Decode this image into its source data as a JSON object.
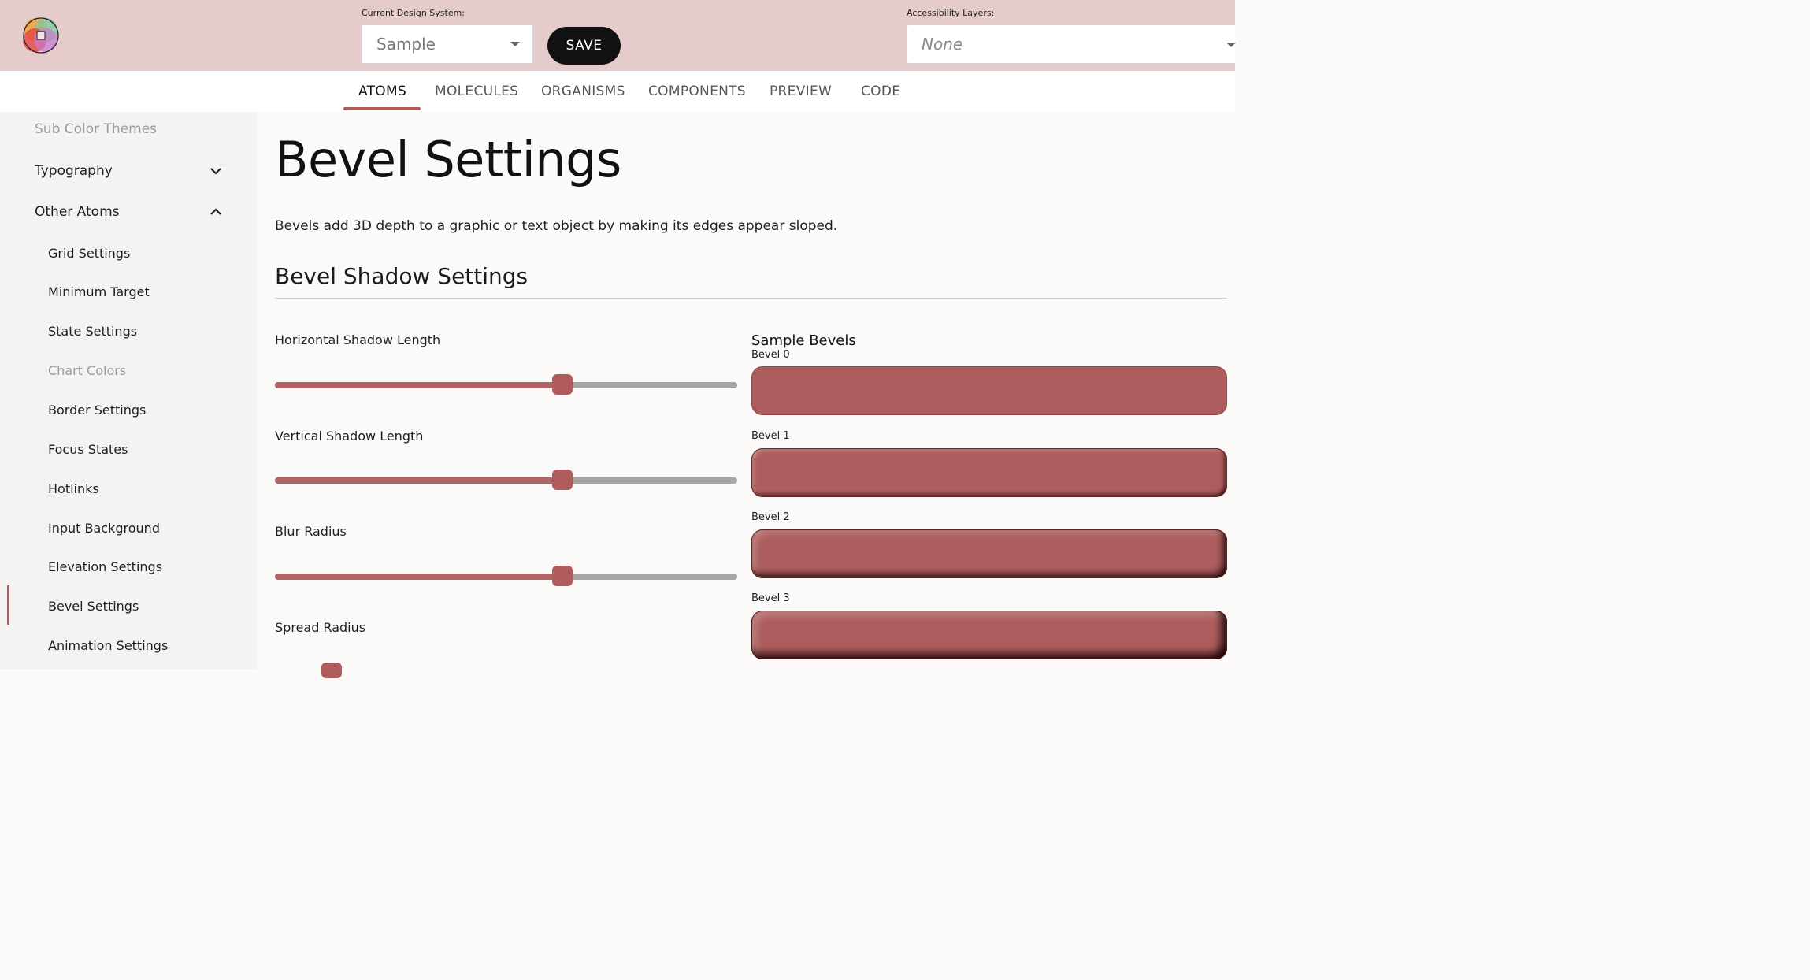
{
  "header": {
    "design_system_label": "Current Design System:",
    "design_system_value": "Sample",
    "save_label": "SAVE",
    "accessibility_label": "Accessibility Layers:",
    "accessibility_value": "None"
  },
  "tabs": [
    {
      "label": "ATOMS",
      "active": true
    },
    {
      "label": "MOLECULES"
    },
    {
      "label": "ORGANISMS"
    },
    {
      "label": "COMPONENTS"
    },
    {
      "label": "PREVIEW"
    },
    {
      "label": "CODE"
    }
  ],
  "sidebar": {
    "sub_color_themes": "Sub Color Themes",
    "typography": "Typography",
    "other_atoms": "Other Atoms",
    "items": [
      {
        "label": "Grid Settings"
      },
      {
        "label": "Minimum Target"
      },
      {
        "label": "State Settings"
      },
      {
        "label": "Chart Colors",
        "muted": true
      },
      {
        "label": "Border Settings"
      },
      {
        "label": "Focus States"
      },
      {
        "label": "Hotlinks"
      },
      {
        "label": "Input Background"
      },
      {
        "label": "Elevation Settings"
      },
      {
        "label": "Bevel Settings",
        "active": true
      },
      {
        "label": "Animation Settings"
      }
    ]
  },
  "main": {
    "title": "Bevel Settings",
    "description": "Bevels add 3D depth to a graphic or text object by making its edges appear sloped.",
    "section_title": "Bevel Shadow Settings",
    "sliders": [
      {
        "label": "Horizontal Shadow Length",
        "fraction": 0.622
      },
      {
        "label": "Vertical Shadow Length",
        "fraction": 0.622
      },
      {
        "label": "Blur Radius",
        "fraction": 0.622
      },
      {
        "label": "Spread Radius"
      }
    ],
    "samples_title": "Sample Bevels",
    "bevels": [
      "Bevel 0",
      "Bevel 1",
      "Bevel 2",
      "Bevel 3"
    ]
  },
  "colors": {
    "accent": "#b05c5d",
    "header_bg": "#e6cbcc",
    "bevel_fill": "#ad5d5e"
  }
}
